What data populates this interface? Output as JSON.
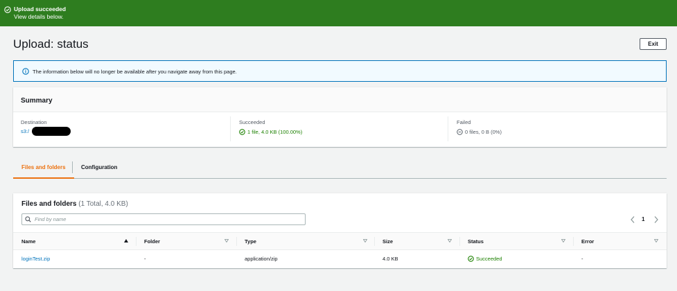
{
  "banner": {
    "title": "Upload succeeded",
    "subtitle": "View details below.",
    "color": "#2e7d1f",
    "icon": "check-circle-icon"
  },
  "header": {
    "title": "Upload: status",
    "exit_label": "Exit"
  },
  "info": {
    "icon": "info-icon",
    "text": "The information below will no longer be available after you navigate away from this page."
  },
  "summary": {
    "title": "Summary",
    "destination_label": "Destination",
    "destination_value": "s3:/",
    "succeeded_label": "Succeeded",
    "succeeded_value": "1 file, 4.0 KB (100.00%)",
    "failed_label": "Failed",
    "failed_value": "0 files, 0 B (0%)"
  },
  "tabs": [
    {
      "label": "Files and folders",
      "active": true
    },
    {
      "label": "Configuration",
      "active": false
    }
  ],
  "files": {
    "title": "Files and folders",
    "count": "(1 Total, 4.0 KB)",
    "search_placeholder": "Find by name",
    "page": "1",
    "columns": [
      "Name",
      "Folder",
      "Type",
      "Size",
      "Status",
      "Error"
    ],
    "rows": [
      {
        "name": "loginTest.zip",
        "folder": "-",
        "type": "application/zip",
        "size": "4.0 KB",
        "status": "Succeeded",
        "error": "-"
      }
    ]
  },
  "colors": {
    "accent_tab": "#ec7211",
    "link": "#0073bb",
    "success": "#1d8102"
  }
}
